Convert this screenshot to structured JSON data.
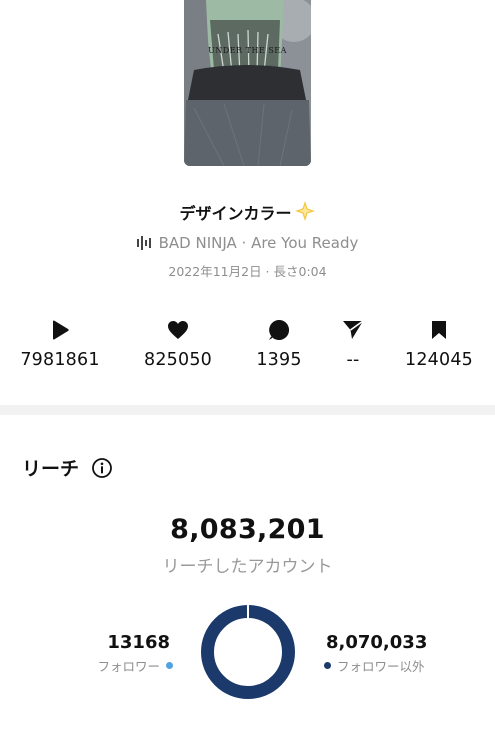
{
  "post": {
    "thumbnail_text": "UNDER THE SEA",
    "title": "デザインカラー",
    "audio": "BAD NINJA · Are You Ready",
    "meta": "2022年11月2日 · 長さ0:04"
  },
  "stats": [
    {
      "icon": "play-icon",
      "value": "7981861"
    },
    {
      "icon": "heart-icon",
      "value": "825050"
    },
    {
      "icon": "comment-icon",
      "value": "1395"
    },
    {
      "icon": "send-icon",
      "value": "--"
    },
    {
      "icon": "bookmark-icon",
      "value": "124045"
    }
  ],
  "reach": {
    "section_title": "リーチ",
    "total": "8,083,201",
    "total_label": "リーチしたアカウント",
    "followers_value": "13168",
    "followers_label": "フォロワー",
    "followers_color": "#4fa3e3",
    "nonfollowers_value": "8,070,033",
    "nonfollowers_label": "フォロワー以外",
    "nonfollowers_color": "#1b3a6b",
    "followers_fraction": 0.0016
  }
}
